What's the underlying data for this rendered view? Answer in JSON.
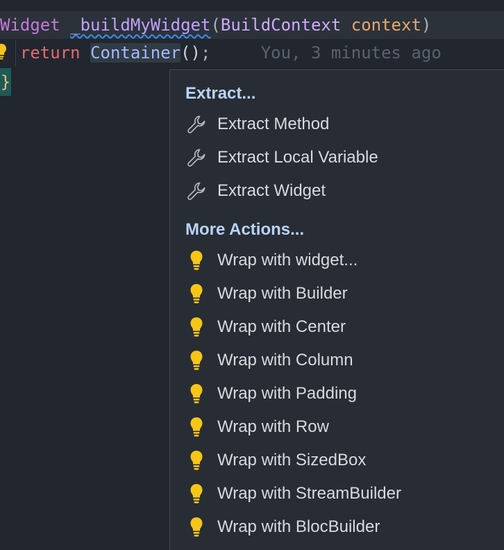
{
  "code": {
    "line1": {
      "type_kw": "Widget",
      "space1": " ",
      "fn_name": "_buildMyWidget",
      "open": "(",
      "param_type": "BuildContext",
      "space2": " ",
      "param_name": "context",
      "close": ")"
    },
    "line2": {
      "indent": "  ",
      "return_kw": "return",
      "space": " ",
      "cls": "Container",
      "parens": "()",
      "semi": ";",
      "blame": "     You, 3 minutes ago"
    },
    "line3": {
      "brace": "}"
    }
  },
  "menu": {
    "sections": [
      {
        "title": "Extract...",
        "items": [
          {
            "label": "Extract Method",
            "icon": "wrench-icon"
          },
          {
            "label": "Extract Local Variable",
            "icon": "wrench-icon"
          },
          {
            "label": "Extract Widget",
            "icon": "wrench-icon"
          }
        ]
      },
      {
        "title": "More Actions...",
        "items": [
          {
            "label": "Wrap with widget...",
            "icon": "lightbulb-icon"
          },
          {
            "label": "Wrap with Builder",
            "icon": "lightbulb-icon"
          },
          {
            "label": "Wrap with Center",
            "icon": "lightbulb-icon"
          },
          {
            "label": "Wrap with Column",
            "icon": "lightbulb-icon"
          },
          {
            "label": "Wrap with Padding",
            "icon": "lightbulb-icon"
          },
          {
            "label": "Wrap with Row",
            "icon": "lightbulb-icon"
          },
          {
            "label": "Wrap with SizedBox",
            "icon": "lightbulb-icon"
          },
          {
            "label": "Wrap with StreamBuilder",
            "icon": "lightbulb-icon"
          },
          {
            "label": "Wrap with BlocBuilder",
            "icon": "lightbulb-icon"
          }
        ]
      }
    ]
  },
  "colors": {
    "section_title": "#b8d4f5",
    "bulb": "#f5c518",
    "wrench": "#aeb4bd"
  }
}
